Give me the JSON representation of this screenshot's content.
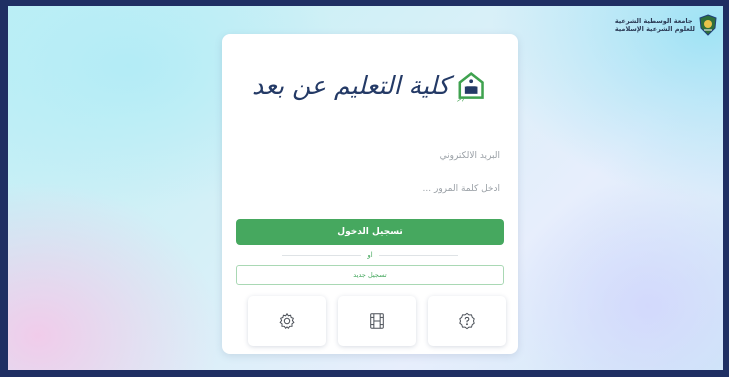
{
  "university": {
    "line1": "جامعة الوسطية الشرعية",
    "line2": "للعلوم الشرعية الإسلامية",
    "emblem_icon": "shield-emblem-icon"
  },
  "brand": {
    "title": "كلية التعليم عن بعد",
    "logo_icon": "green-book-house-icon"
  },
  "form": {
    "email_placeholder": "البريد الالكتروني",
    "password_placeholder": "أدخل كلمة المرور ...",
    "login_label": "تسجيل الدخول",
    "or_label": "او",
    "register_label": "تسجيل جديد"
  },
  "tiles": [
    {
      "icon": "help-icon"
    },
    {
      "icon": "film-icon"
    },
    {
      "icon": "settings-icon"
    }
  ],
  "colors": {
    "accent_green": "#46a85f",
    "brand_navy": "#243a66",
    "frame": "#1f2f63"
  }
}
